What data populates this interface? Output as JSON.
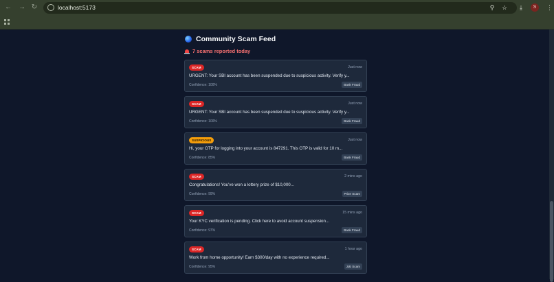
{
  "browser": {
    "url": "localhost:5173",
    "avatar_letter": "S"
  },
  "feed": {
    "title": "Community Scam Feed",
    "count_text": "7 scams reported today",
    "items": [
      {
        "badge": "SCAM",
        "badge_type": "scam",
        "time": "Just now",
        "message": "URGENT: Your SBI account has been suspended due to suspicious activity. Verify y...",
        "confidence": "Confidence: 100%",
        "category": "Bank Fraud"
      },
      {
        "badge": "SCAM",
        "badge_type": "scam",
        "time": "Just now",
        "message": "URGENT: Your SBI account has been suspended due to suspicious activity. Verify y...",
        "confidence": "Confidence: 100%",
        "category": "Bank Fraud"
      },
      {
        "badge": "SUSPICIOUS",
        "badge_type": "suspicious",
        "time": "Just now",
        "message": "Hi, your OTP for logging into your account is 847291. This OTP is valid for 10 m...",
        "confidence": "Confidence: 85%",
        "category": "Bank Fraud"
      },
      {
        "badge": "SCAM",
        "badge_type": "scam",
        "time": "2 mins ago",
        "message": "Congratulations! You've won a lottery prize of $10,000...",
        "confidence": "Confidence: 99%",
        "category": "Prize Scam"
      },
      {
        "badge": "SCAM",
        "badge_type": "scam",
        "time": "15 mins ago",
        "message": "Your KYC verification is pending. Click here to avoid account suspension...",
        "confidence": "Confidence: 97%",
        "category": "Bank Fraud"
      },
      {
        "badge": "SCAM",
        "badge_type": "scam",
        "time": "1 hour ago",
        "message": "Work from home opportunity! Earn $300/day with no experience required...",
        "confidence": "Confidence: 95%",
        "category": "Job Scam"
      }
    ]
  },
  "colors": {
    "background": "#0f172a",
    "card": "#1e293b",
    "scam_badge": "#dc2626",
    "suspicious_badge": "#f59e0b",
    "count_text": "#f87171"
  }
}
